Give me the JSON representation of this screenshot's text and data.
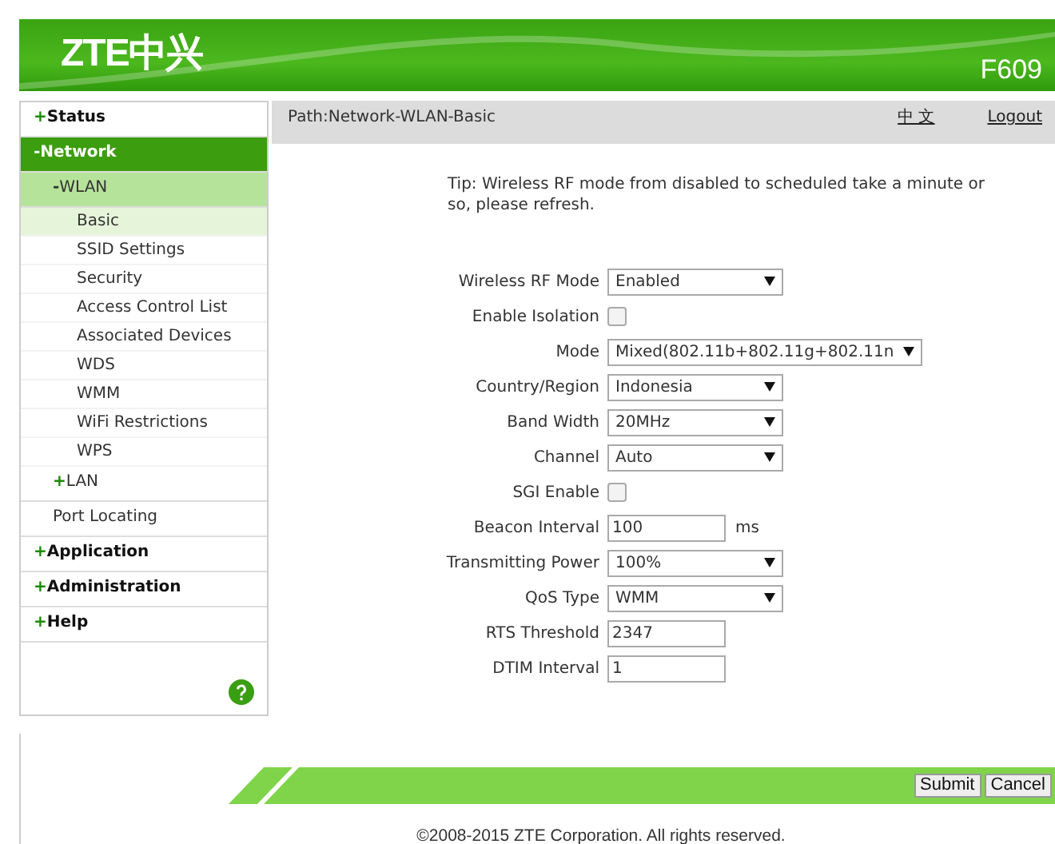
{
  "header": {
    "logo": "ZTE中兴",
    "model": "F609"
  },
  "sidebar": {
    "items": [
      {
        "sign": "+",
        "label": "Status",
        "expanded": false
      },
      {
        "sign": "-",
        "label": "Network",
        "expanded": true,
        "children": [
          {
            "sign": "-",
            "label": "WLAN",
            "expanded": true,
            "children": [
              {
                "label": "Basic",
                "selected": true
              },
              {
                "label": "SSID Settings",
                "selected": false
              },
              {
                "label": "Security",
                "selected": false
              },
              {
                "label": "Access Control List",
                "selected": false
              },
              {
                "label": "Associated Devices",
                "selected": false
              },
              {
                "label": "WDS",
                "selected": false
              },
              {
                "label": "WMM",
                "selected": false
              },
              {
                "label": "WiFi Restrictions",
                "selected": false
              },
              {
                "label": "WPS",
                "selected": false
              }
            ]
          },
          {
            "sign": "+",
            "label": "LAN",
            "expanded": false
          },
          {
            "label": "Port Locating",
            "selected": false
          }
        ]
      },
      {
        "sign": "+",
        "label": "Application",
        "expanded": false
      },
      {
        "sign": "+",
        "label": "Administration",
        "expanded": false
      },
      {
        "sign": "+",
        "label": "Help",
        "expanded": false
      }
    ]
  },
  "path_bar": {
    "path": "Path:Network-WLAN-Basic",
    "language_link": "中 文",
    "logout_link": "Logout"
  },
  "tip": "Tip: Wireless RF mode from disabled to scheduled take a minute or so, please refresh.",
  "form": [
    {
      "kind": "select",
      "label": "Wireless RF Mode",
      "value": "Enabled"
    },
    {
      "kind": "checkbox",
      "label": "Enable Isolation",
      "checked": false
    },
    {
      "kind": "select",
      "label": "Mode",
      "value": "Mixed(802.11b+802.11g+802.11n"
    },
    {
      "kind": "select",
      "label": "Country/Region",
      "value": "Indonesia"
    },
    {
      "kind": "select",
      "label": "Band Width",
      "value": "20MHz"
    },
    {
      "kind": "select",
      "label": "Channel",
      "value": "Auto"
    },
    {
      "kind": "checkbox",
      "label": "SGI Enable",
      "checked": false
    },
    {
      "kind": "text",
      "label": "Beacon Interval",
      "value": "100",
      "unit": "ms"
    },
    {
      "kind": "select",
      "label": "Transmitting Power",
      "value": "100%"
    },
    {
      "kind": "select",
      "label": "QoS Type",
      "value": "WMM"
    },
    {
      "kind": "text",
      "label": "RTS Threshold",
      "value": "2347"
    },
    {
      "kind": "text",
      "label": "DTIM Interval",
      "value": "1"
    }
  ],
  "buttons": [
    "Submit",
    "Cancel"
  ],
  "footer": "©2008-2015 ZTE Corporation. All rights reserved."
}
